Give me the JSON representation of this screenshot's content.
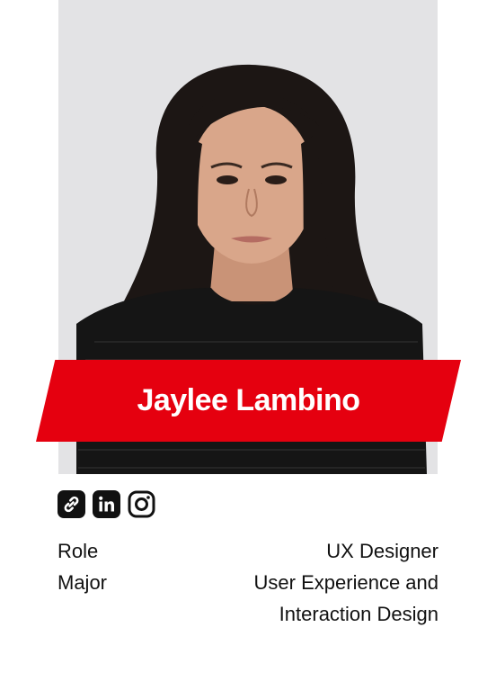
{
  "profile": {
    "name": "Jaylee Lambino"
  },
  "socials": [
    {
      "icon": "link-icon"
    },
    {
      "icon": "linkedin-icon"
    },
    {
      "icon": "instagram-icon"
    }
  ],
  "details": {
    "role_label": "Role",
    "role_value": "UX Designer",
    "major_label": "Major",
    "major_value_line1": "User Experience and",
    "major_value_line2": "Interaction Design"
  },
  "colors": {
    "accent": "#e5000f",
    "text": "#111111",
    "photo_bg": "#e3e3e5"
  }
}
